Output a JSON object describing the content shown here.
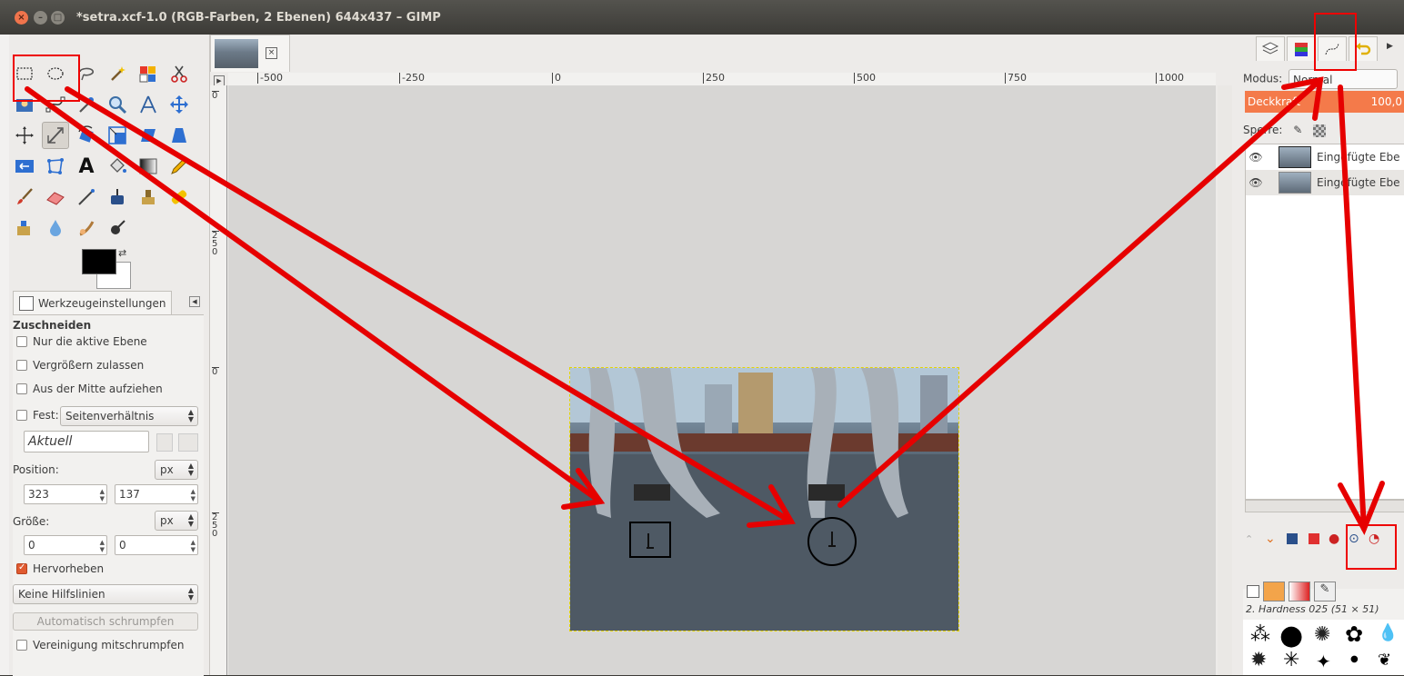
{
  "window": {
    "title": "*setra.xcf-1.0 (RGB-Farben, 2 Ebenen) 644x437 – GIMP",
    "close_glyph": "×",
    "min_glyph": "–",
    "max_glyph": "□"
  },
  "toolbox": {
    "tools": [
      {
        "id": "rect-select",
        "name": "rect-select-icon"
      },
      {
        "id": "ellipse-select",
        "name": "ellipse-select-icon"
      },
      {
        "id": "free-select",
        "name": "lasso-icon"
      },
      {
        "id": "fuzzy-select",
        "name": "magic-wand-icon"
      },
      {
        "id": "color-select",
        "name": "color-select-icon"
      },
      {
        "id": "scissors",
        "name": "scissors-icon"
      },
      {
        "id": "foreground-select",
        "name": "foreground-select-icon"
      },
      {
        "id": "paths",
        "name": "paths-icon"
      },
      {
        "id": "color-picker",
        "name": "color-picker-icon"
      },
      {
        "id": "zoom",
        "name": "zoom-icon"
      },
      {
        "id": "measure",
        "name": "measure-icon"
      },
      {
        "id": "move",
        "name": "move-icon"
      },
      {
        "id": "align",
        "name": "align-icon"
      },
      {
        "id": "crop",
        "name": "crop-icon"
      },
      {
        "id": "rotate",
        "name": "rotate-icon"
      },
      {
        "id": "scale",
        "name": "scale-icon"
      },
      {
        "id": "shear",
        "name": "shear-icon"
      },
      {
        "id": "perspective",
        "name": "perspective-icon"
      },
      {
        "id": "flip",
        "name": "flip-icon"
      },
      {
        "id": "cage",
        "name": "cage-icon"
      },
      {
        "id": "text",
        "name": "text-icon"
      },
      {
        "id": "bucket-fill",
        "name": "bucket-fill-icon"
      },
      {
        "id": "gradient",
        "name": "gradient-icon"
      },
      {
        "id": "pencil",
        "name": "pencil-icon"
      },
      {
        "id": "paintbrush",
        "name": "paintbrush-icon"
      },
      {
        "id": "eraser",
        "name": "eraser-icon"
      },
      {
        "id": "airbrush",
        "name": "airbrush-icon"
      },
      {
        "id": "ink",
        "name": "ink-icon"
      },
      {
        "id": "clone",
        "name": "clone-icon"
      },
      {
        "id": "heal",
        "name": "heal-icon"
      },
      {
        "id": "perspective-clone",
        "name": "perspective-clone-icon"
      },
      {
        "id": "blur",
        "name": "blur-icon"
      },
      {
        "id": "smudge",
        "name": "smudge-icon"
      },
      {
        "id": "dodge-burn",
        "name": "dodge-burn-icon"
      }
    ],
    "text_tool_glyph": "A",
    "fg_color": "#000000",
    "bg_color": "#ffffff"
  },
  "tool_options": {
    "tab_label": "Werkzeugeinstellungen",
    "section": "Zuschneiden",
    "only_active_layer": "Nur die aktive Ebene",
    "allow_growing": "Vergrößern zulassen",
    "expand_from_center": "Aus der Mitte aufziehen",
    "fixed_label": "Fest:",
    "fixed_value": "Seitenverhältnis",
    "current_value": "Aktuell",
    "position_label": "Position:",
    "position_unit": "px",
    "position_x": "323",
    "position_y": "137",
    "size_label": "Größe:",
    "size_unit": "px",
    "size_w": "0",
    "size_h": "0",
    "highlight": "Hervorheben",
    "guides_value": "Keine Hilfslinien",
    "autoshrink": "Automatisch schrumpfen",
    "shrink_merged": "Vereinigung mitschrumpfen"
  },
  "ruler": {
    "h_labels": [
      "-500",
      "-250",
      "0",
      "250",
      "500",
      "750",
      "1000"
    ],
    "v_labels": [
      "0",
      "250",
      "0",
      "250"
    ]
  },
  "layers_panel": {
    "mode_label": "Modus:",
    "mode_value": "Normal",
    "opacity_label": "Deckkraft",
    "opacity_value": "100,0",
    "lock_label": "Sperre:",
    "layers": [
      {
        "name": "Eingefügte Ebe",
        "visible": true
      },
      {
        "name": "Eingefügte Ebe",
        "visible": true
      }
    ],
    "eye_glyph": "👁"
  },
  "brushes": {
    "current": "2. Hardness 025 (51 × 51)"
  },
  "colors": {
    "accent": "#e05a30",
    "annotation_red": "#e60000",
    "opacity_bar": "#f47a4a"
  }
}
